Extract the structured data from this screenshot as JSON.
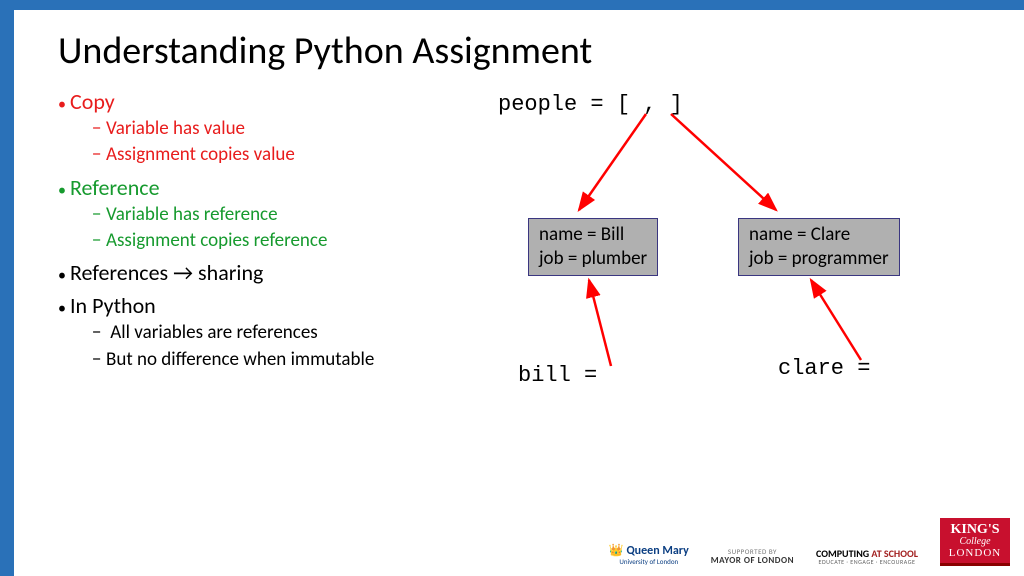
{
  "title": "Understanding Python Assignment",
  "bullets": {
    "copy": {
      "label": "Copy",
      "sub1": "Variable has value",
      "sub2": "Assignment copies value"
    },
    "ref": {
      "label": "Reference",
      "sub1": "Variable has reference",
      "sub2": "Assignment copies reference"
    },
    "share": {
      "label": "References → sharing"
    },
    "python": {
      "label": "In Python",
      "sub1": " All variables are references",
      "sub2": "But no difference when immutable"
    }
  },
  "diagram": {
    "people": "people = [ , ]",
    "box1_l1": "name = Bill",
    "box1_l2": "job = plumber",
    "box2_l1": "name = Clare",
    "box2_l2": "job = programmer",
    "var1": "bill =",
    "var2": "clare ="
  },
  "logos": {
    "qm": "Queen Mary",
    "qm_sub": "University of London",
    "mayor_sup": "SUPPORTED BY",
    "mayor": "MAYOR OF LONDON",
    "cas_a": "COMPUTING ",
    "cas_b": "AT SCHOOL",
    "cas_sub": "EDUCATE · ENGAGE · ENCOURAGE",
    "kcl_k": "KING'S",
    "kcl_c": "College",
    "kcl_l": "LONDON"
  }
}
